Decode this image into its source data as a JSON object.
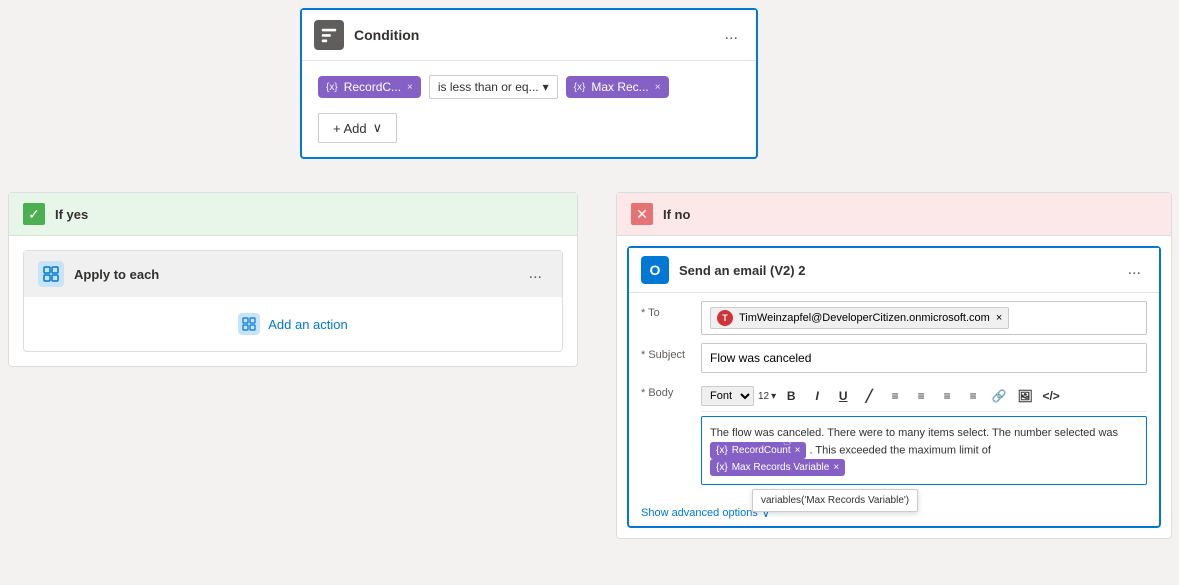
{
  "condition": {
    "title": "Condition",
    "icon": "condition-icon",
    "ellipsis": "...",
    "pill1": {
      "label": "RecordC...",
      "icon": "{x}"
    },
    "operator": "is less than or eq...",
    "pill2": {
      "label": "Max Rec...",
      "icon": "{x}"
    },
    "add_label": "+ Add",
    "add_chevron": "∨"
  },
  "if_yes": {
    "title": "If yes",
    "apply_to_each": {
      "title": "Apply to each",
      "ellipsis": "..."
    },
    "add_action": "Add an action"
  },
  "if_no": {
    "title": "If no",
    "send_email": {
      "title": "Send an email (V2) 2",
      "ellipsis": "...",
      "to_label": "* To",
      "to_value": "TimWeinzapfel@DeveloperCitizen.onmicrosoft.com",
      "subject_label": "* Subject",
      "subject_value": "Flow was canceled",
      "body_label": "* Body",
      "font_label": "Font",
      "font_size": "12",
      "body_text_before": "The flow was canceled. There were to many items select. The number selected was",
      "inline_tag1": "RecordCount",
      "body_text_middle": ". This exceeded the maximum limit of",
      "inline_tag2": "Max Records Variable",
      "tooltip_text": "variables('Max Records Variable')",
      "show_advanced": "Show advanced options",
      "toolbar_items": [
        "Font",
        "12",
        "B",
        "I",
        "U",
        "╱",
        "≡",
        "≡",
        "≡",
        "≡",
        "🔗",
        "🖼",
        "</>"
      ]
    }
  }
}
